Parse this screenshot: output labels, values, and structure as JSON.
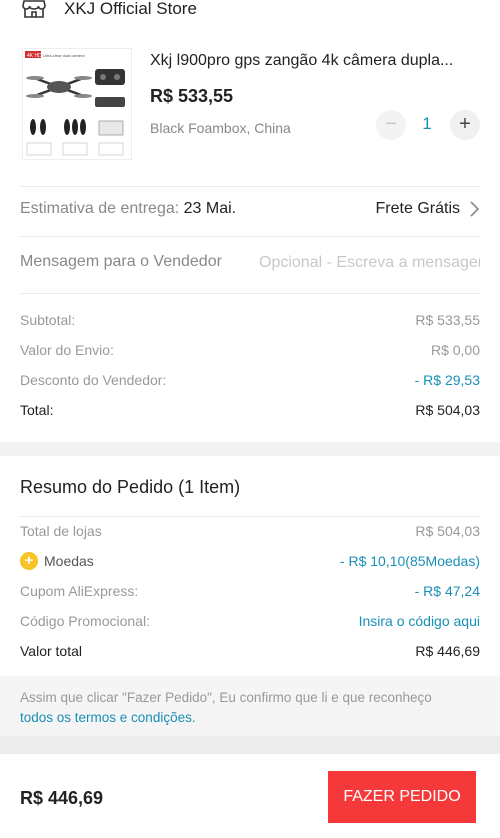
{
  "store": {
    "name": "XKJ Official Store",
    "icon": "store-icon"
  },
  "product": {
    "title": "Xkj l900pro gps zangão 4k câmera dupla...",
    "price": "R$ 533,55",
    "variant": "Black Foambox, China",
    "quantity": "1",
    "qty_minus": "−",
    "qty_plus": "+",
    "thumb_badge": "4K HD",
    "thumb_caption": "Ultra-clear dual camera"
  },
  "delivery": {
    "label": "Estimativa de entrega: ",
    "date": "23 Mai.",
    "shipping": "Frete Grátis"
  },
  "message": {
    "label": "Mensagem para o Vendedor",
    "placeholder": "Opcional - Escreva a mensagem"
  },
  "summary": {
    "subtotal_label": "Subtotal:",
    "subtotal_value": "R$ 533,55",
    "shipping_label": "Valor do Envio:",
    "shipping_value": "R$ 0,00",
    "discount_label": "Desconto do Vendedor:",
    "discount_value": "- R$ 29,53",
    "total_label": "Total:",
    "total_value": "R$ 504,03"
  },
  "order_summary": {
    "title": "Resumo do Pedido (1 Item)",
    "stores_label": "Total de lojas",
    "stores_value": "R$ 504,03",
    "coins_label": "Moedas",
    "coins_value": "- R$ 10,10(85Moedas)",
    "coupon_label": "Cupom AliExpress:",
    "coupon_value": "- R$ 47,24",
    "promo_label": "Código Promocional:",
    "promo_value": "Insira o código aqui",
    "grand_label": "Valor total",
    "grand_value": "R$ 446,69"
  },
  "terms": {
    "text": "Assim que clicar \"Fazer Pedido\", Eu confirmo que li e que reconheço",
    "link": "todos os termos e condições."
  },
  "footer": {
    "total": "R$ 446,69",
    "button": "FAZER PEDIDO"
  },
  "colors": {
    "accent_red": "#f5393a",
    "link_blue": "#1a8fb5",
    "coin_yellow": "#f7c325"
  }
}
